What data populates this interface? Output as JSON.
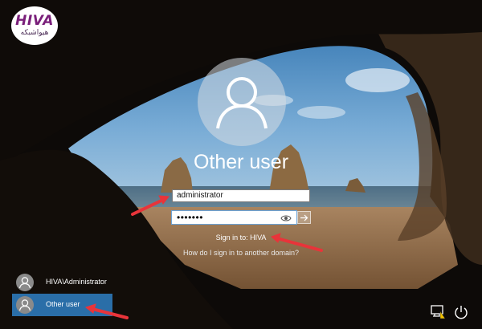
{
  "logo": {
    "brand": "HIVA",
    "subtitle": "هیواشبکه"
  },
  "login": {
    "title": "Other user",
    "username_value": "administrator",
    "password_mask": "•••••••",
    "sign_in_to": "Sign in to: HIVA",
    "domain_help": "How do I sign in to another domain?"
  },
  "users": [
    {
      "label": "HIVA\\Administrator"
    },
    {
      "label": "Other user",
      "selected": true
    }
  ],
  "system_tray": {
    "network_icon": "network-icon",
    "ease_of_access_icon": "ease-of-access-icon",
    "power_icon": "power-icon"
  },
  "colors": {
    "selected_user": "#2a6ea8",
    "annotation_arrow": "#e8343a"
  }
}
